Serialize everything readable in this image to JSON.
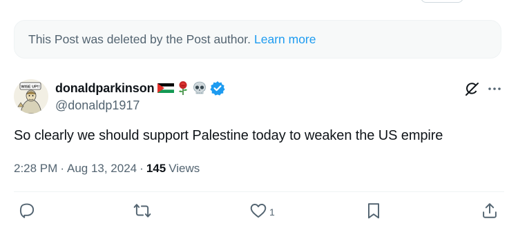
{
  "deleted_notice": {
    "text": "This Post was deleted by the Post author.",
    "link_label": "Learn more"
  },
  "author": {
    "display_name": "donaldparkinson",
    "emojis": [
      "palestine-flag-icon",
      "rose-icon",
      "skull-icon"
    ],
    "handle": "@donaldp1917",
    "avatar_caption": "WISE UP!!"
  },
  "post": {
    "text": "So clearly we should support Palestine today to weaken the US empire",
    "time": "2:28 PM",
    "date": "Aug 13, 2024",
    "separator": "·",
    "views_count": "145",
    "views_label": "Views"
  },
  "actions": {
    "reply_count": "",
    "repost_count": "",
    "like_count": "1"
  },
  "colors": {
    "accent": "#1d9bf0",
    "secondary_text": "#536471",
    "primary_text": "#0f1419",
    "verified_badge": "#1d9bf0"
  }
}
